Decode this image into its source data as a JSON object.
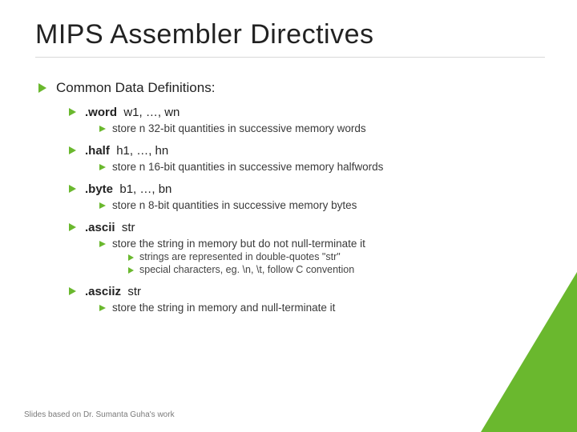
{
  "title": "MIPS Assembler Directives",
  "section": "Common Data Definitions:",
  "items": [
    {
      "directive": ".word",
      "args": "w1, …, wn",
      "desc": "store n 32-bit quantities in successive memory words"
    },
    {
      "directive": ".half",
      "args": "h1, …, hn",
      "desc": "store n 16-bit quantities in successive memory halfwords"
    },
    {
      "directive": ".byte",
      "args": "b1, …, bn",
      "desc": "store n 8-bit quantities in successive memory bytes"
    },
    {
      "directive": ".ascii",
      "args": "str",
      "desc": "store the string in memory but do not null-terminate it",
      "sub": [
        "strings are represented in double-quotes \"str\"",
        "special characters, eg. \\n, \\t, follow C convention"
      ]
    },
    {
      "directive": ".asciiz",
      "args": "str",
      "desc": "store the string in memory and null-terminate it"
    }
  ],
  "footer": "Slides based on Dr. Sumanta Guha's work"
}
